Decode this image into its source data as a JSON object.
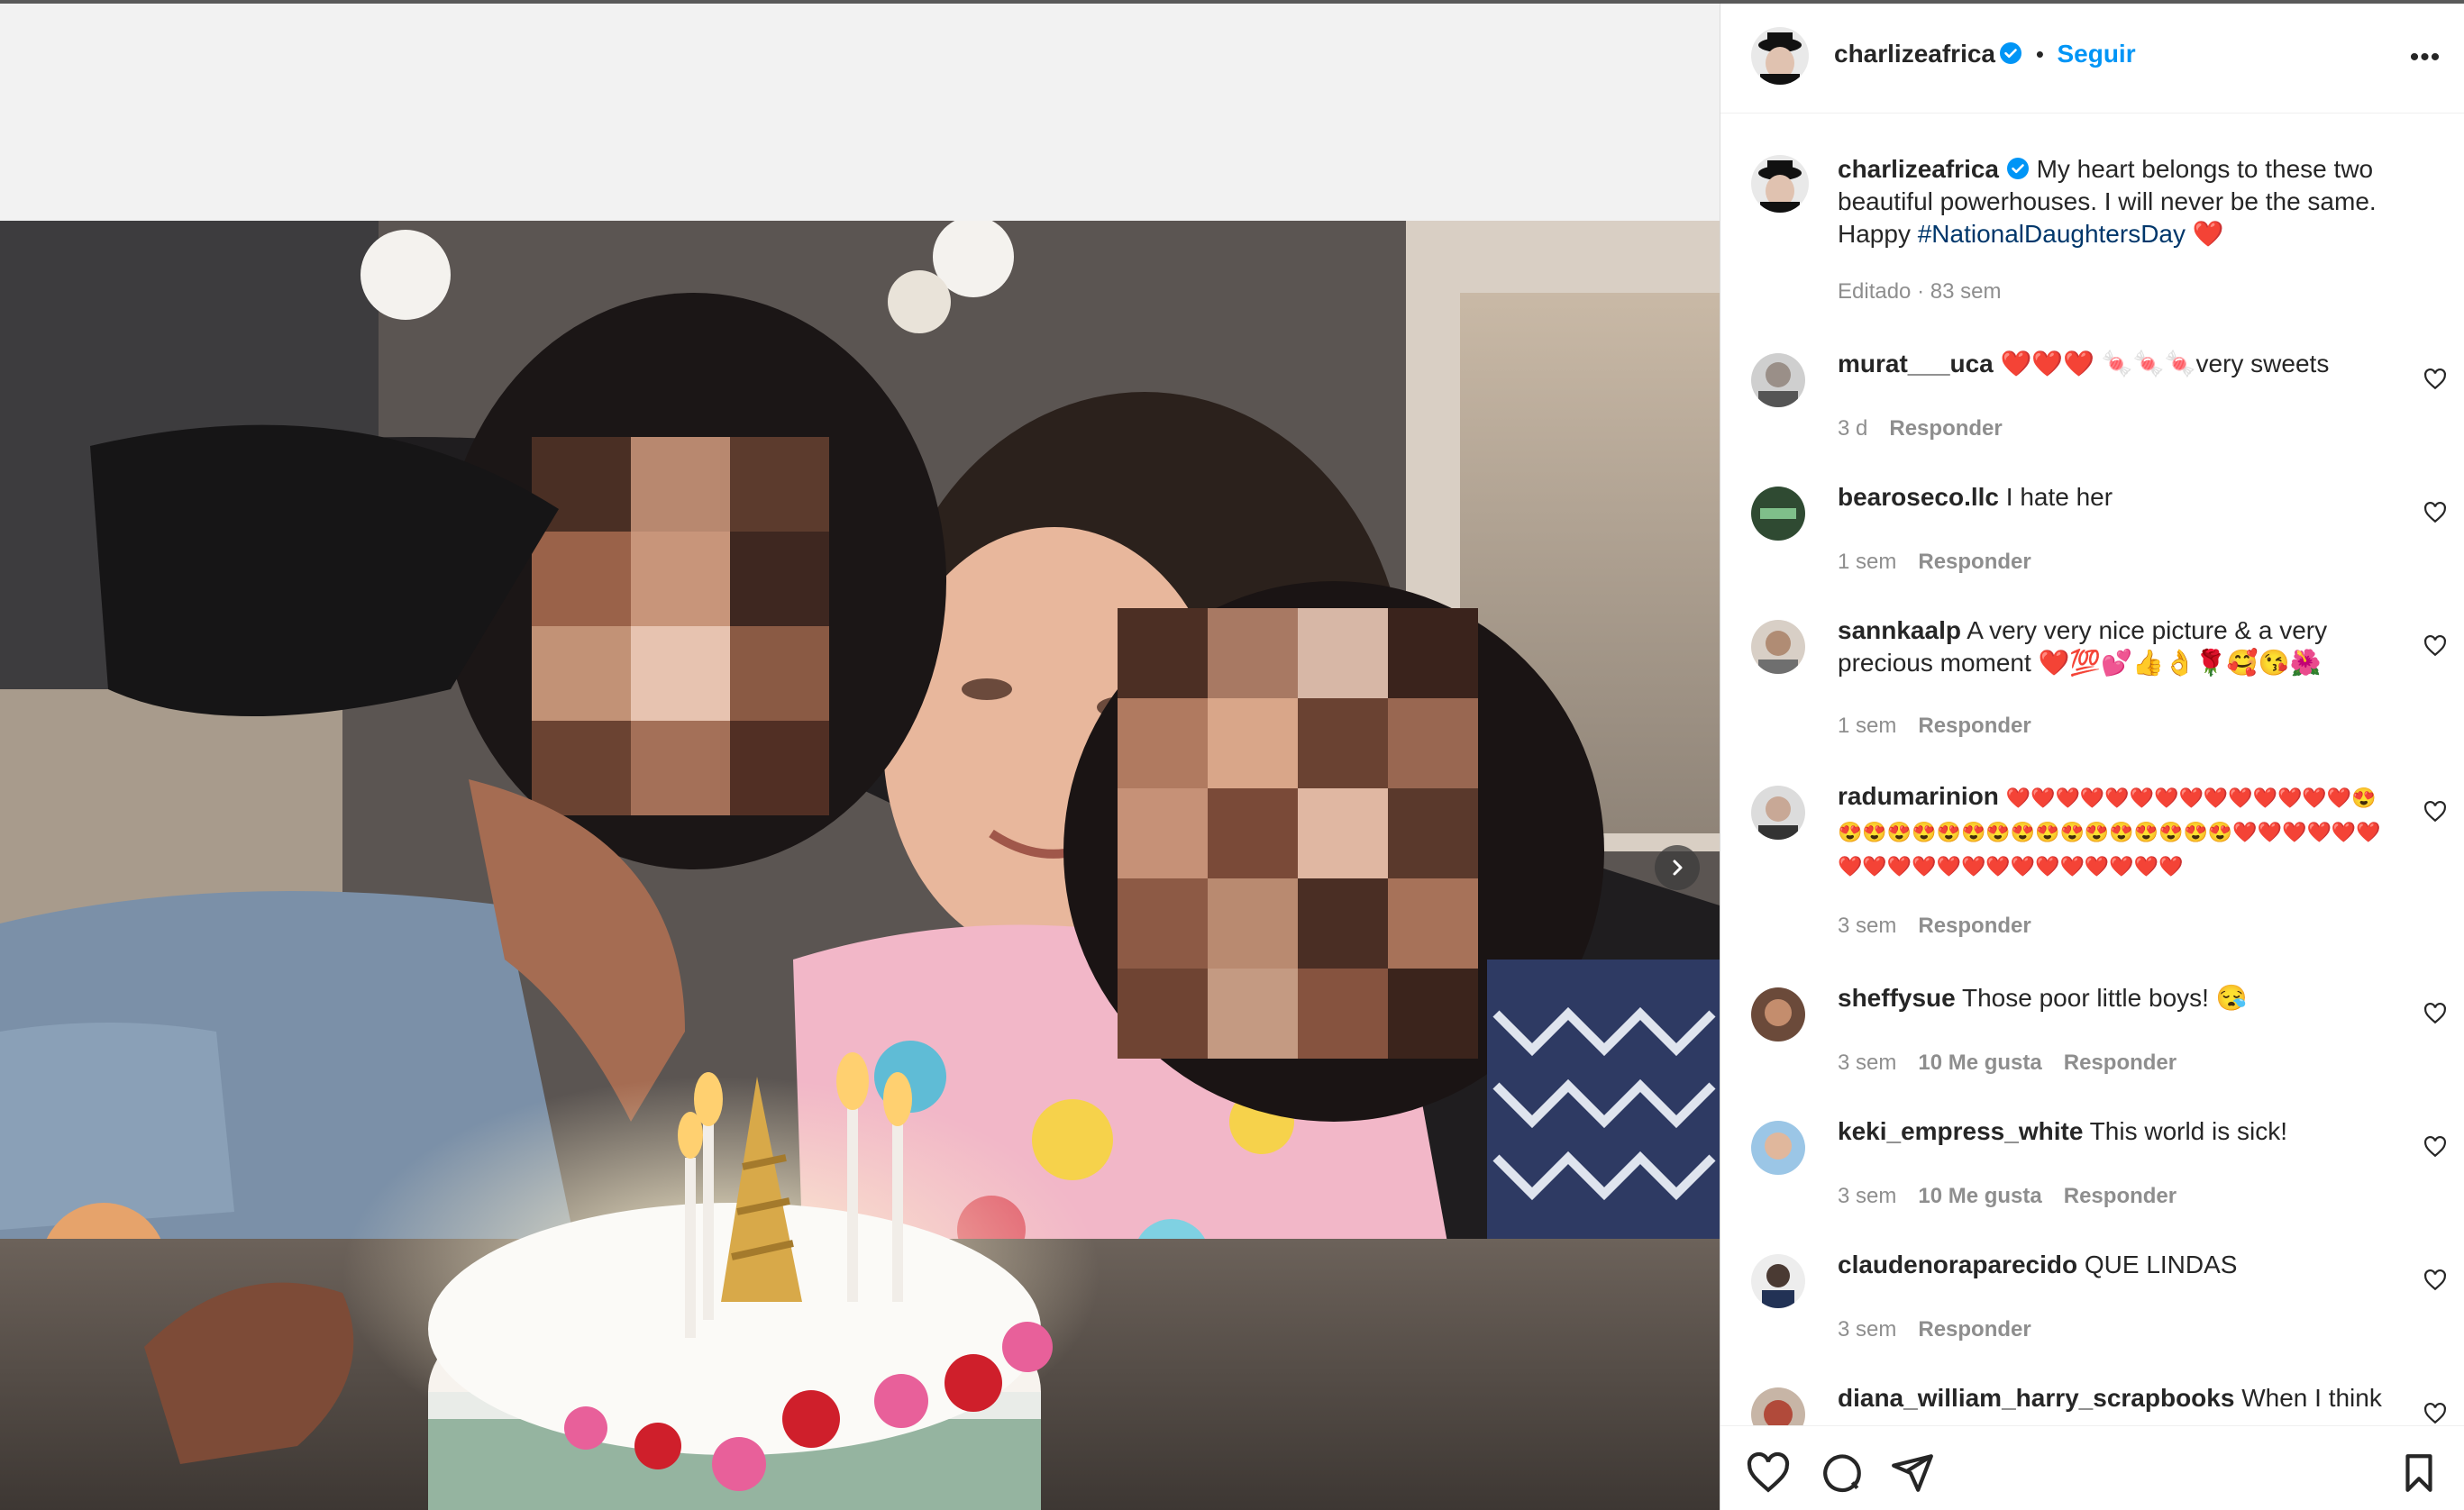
{
  "post": {
    "author": "charlizeafrica",
    "follow_label": "Seguir",
    "separator": "•",
    "more_label": "•••",
    "caption_text": "My heart belongs to these two beautiful powerhouses. I will never be the same. Happy ",
    "caption_hashtag": "#NationalDaughtersDay",
    "caption_emoji": "❤️",
    "edited_meta": "Editado · 83 sem"
  },
  "comments": [
    {
      "user": "murat___uca",
      "text": "❤️❤️❤️ 🍬🍬🍬very sweets",
      "time": "3 d",
      "likes": "",
      "reply": "Responder"
    },
    {
      "user": "bearoseco.llc",
      "text": "I hate her",
      "time": "1 sem",
      "likes": "",
      "reply": "Responder"
    },
    {
      "user": "sannkaalp",
      "text": "A very very nice picture & a very precious moment ❤️💯💕👍👌🌹🥰😘🌺",
      "time": "1 sem",
      "likes": "",
      "reply": "Responder"
    },
    {
      "user": "radumarinion",
      "text": "❤️❤️❤️❤️❤️❤️❤️❤️❤️❤️❤️❤️❤️❤️😍😍😍😍😍😍😍😍😍😍😍😍😍😍😍😍😍❤️❤️❤️❤️❤️❤️❤️❤️❤️❤️❤️❤️❤️❤️❤️❤️❤️❤️❤️❤️",
      "time": "3 sem",
      "likes": "",
      "reply": "Responder"
    },
    {
      "user": "sheffysue",
      "text": "Those poor little boys! 😪",
      "time": "3 sem",
      "likes": "10 Me gusta",
      "reply": "Responder"
    },
    {
      "user": "keki_empress_white",
      "text": "This world is sick!",
      "time": "3 sem",
      "likes": "10 Me gusta",
      "reply": "Responder"
    },
    {
      "user": "claudenoraparecido",
      "text": "QUE LINDAS",
      "time": "3 sem",
      "likes": "",
      "reply": "Responder"
    },
    {
      "user": "diana_william_harry_scrapbooks",
      "text": "When I think",
      "time": "",
      "likes": "",
      "reply": ""
    }
  ],
  "colors": {
    "accent": "#0095f6",
    "text": "#262626",
    "muted": "#8e8e8e",
    "hashtag": "#00376b",
    "like_red": "#ed4956"
  },
  "icons": [
    "verified-badge-icon",
    "more-options-icon",
    "heart-icon",
    "comment-icon",
    "share-icon",
    "bookmark-icon",
    "chevron-right-icon"
  ]
}
